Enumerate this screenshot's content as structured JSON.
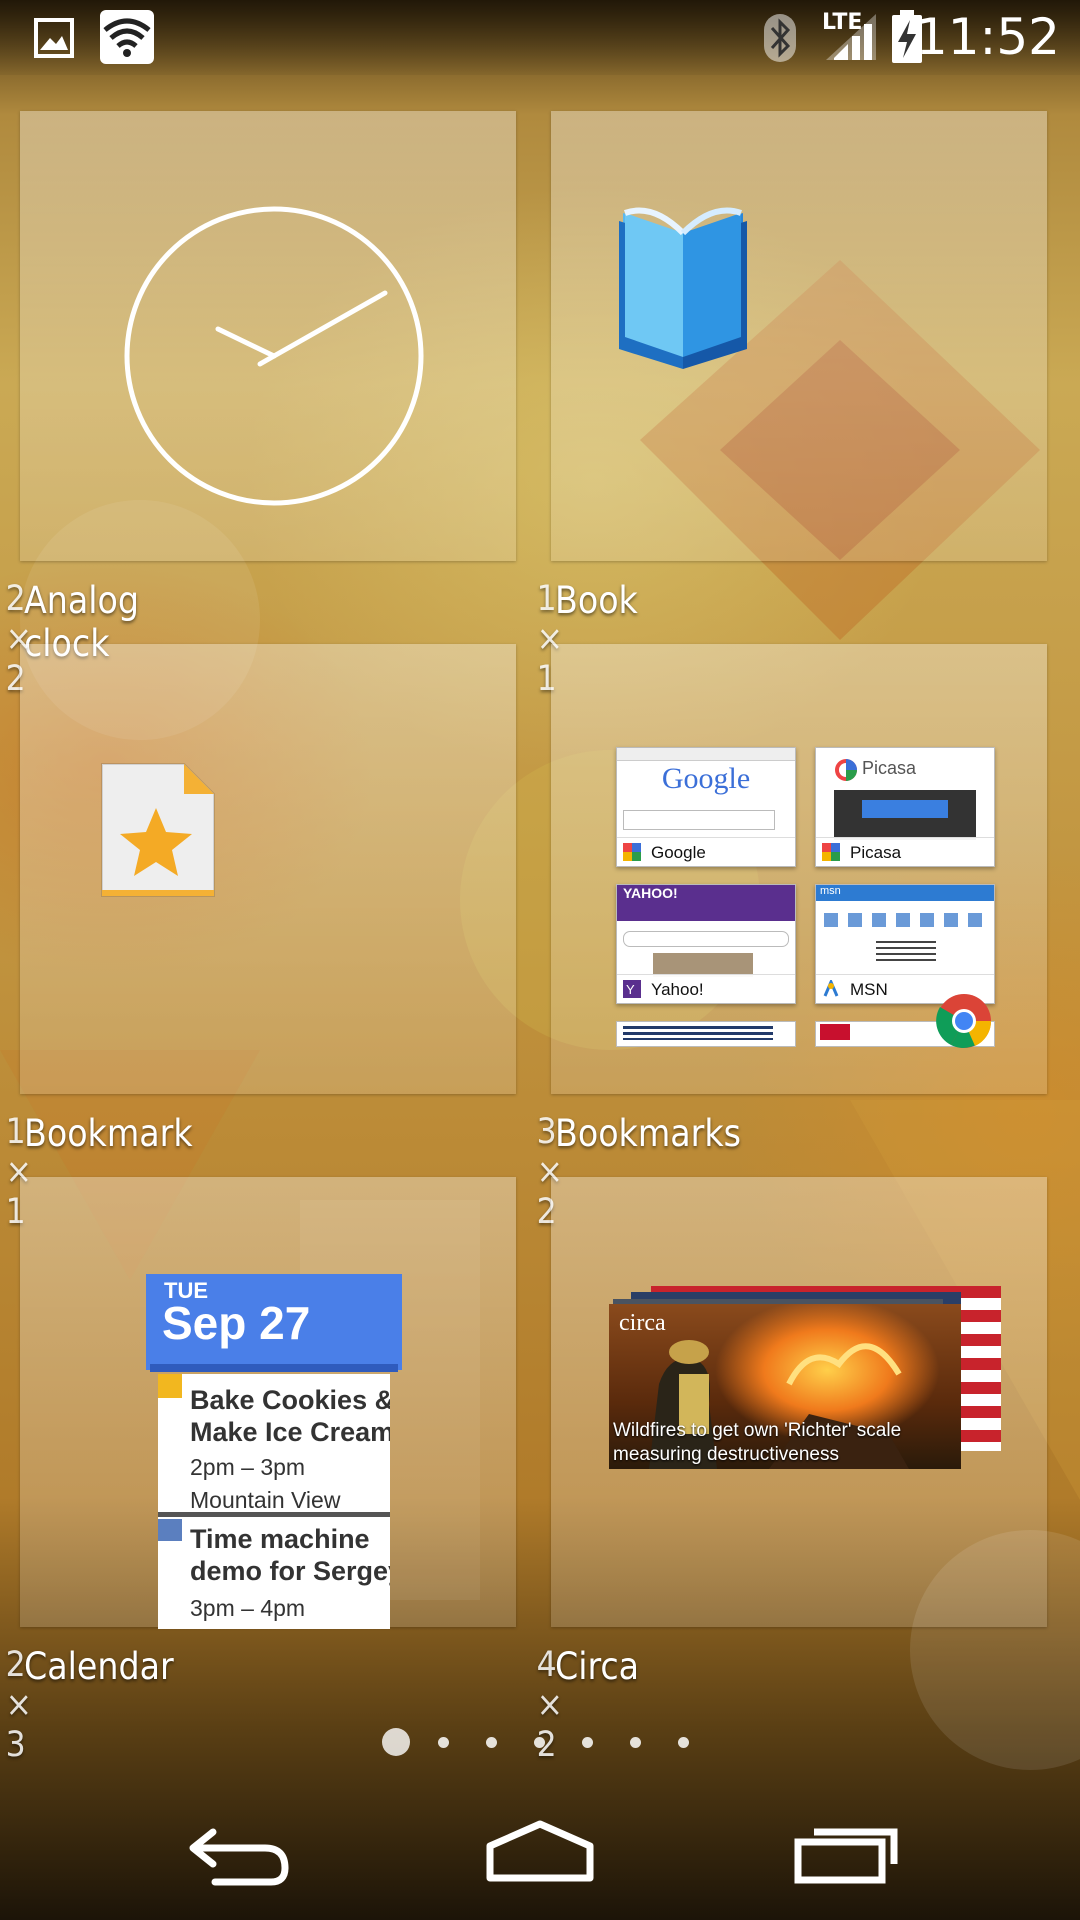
{
  "status_bar": {
    "time": "11:52",
    "network": "LTE",
    "icons": [
      "gallery-icon",
      "wifi-icon",
      "bluetooth-icon",
      "signal-icon",
      "battery-charging-icon"
    ]
  },
  "widgets": [
    {
      "label": "Analog clock",
      "size": "2 × 2"
    },
    {
      "label": "Book",
      "size": "1 × 1"
    },
    {
      "label": "Bookmark",
      "size": "1 × 1"
    },
    {
      "label": "Bookmarks",
      "size": "3 × 2"
    },
    {
      "label": "Calendar",
      "size": "2 × 3"
    },
    {
      "label": "Circa",
      "size": "4 × 2"
    }
  ],
  "bookmarks_preview": [
    {
      "title": "Google",
      "logo": "Google"
    },
    {
      "title": "Picasa",
      "logo": "Picasa"
    },
    {
      "title": "Yahoo!",
      "logo": "YAHOO!"
    },
    {
      "title": "MSN",
      "logo": "msn"
    }
  ],
  "calendar_preview": {
    "day": "TUE",
    "date": "Sep 27",
    "events": [
      {
        "title_line1": "Bake Cookies &",
        "title_line2": "Make Ice Cream",
        "time": "2pm – 3pm",
        "location": "Mountain View",
        "color": "#f2b71f"
      },
      {
        "title_line1": "Time machine",
        "title_line2": "demo for Sergey",
        "time": "3pm – 4pm",
        "color": "#5b7fbf"
      }
    ]
  },
  "circa_preview": {
    "brand": "circa",
    "headline_line1": "Wildfires to get own 'Richter' scale",
    "headline_line2": "measuring destructiveness"
  },
  "page_indicator": {
    "count": 7,
    "active": 1
  },
  "nav_bar": [
    "back-button",
    "home-button",
    "recents-button"
  ]
}
